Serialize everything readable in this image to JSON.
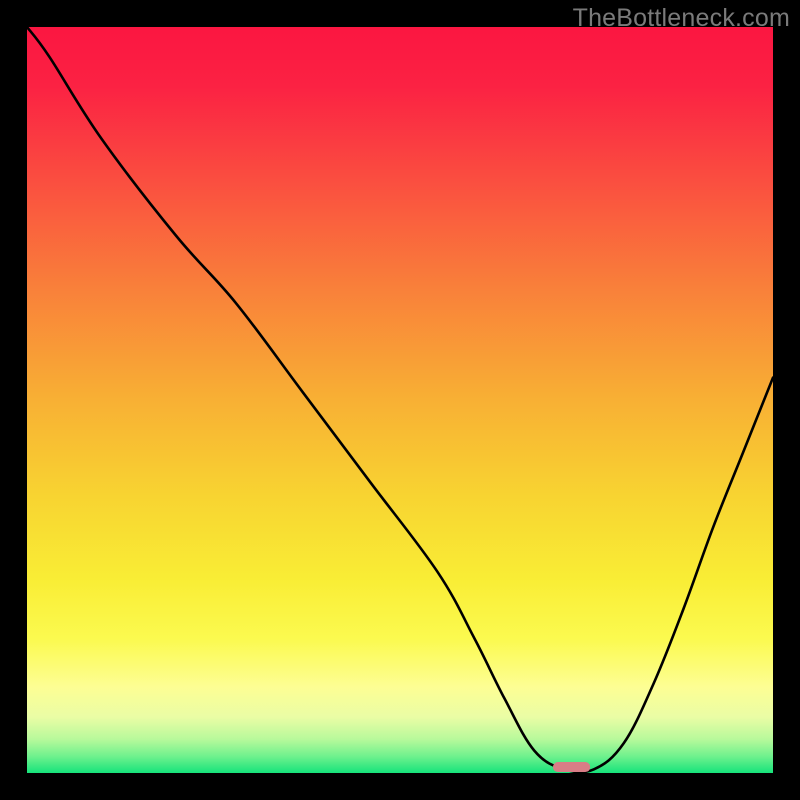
{
  "watermark": "TheBottleneck.com",
  "chart_data": {
    "type": "line",
    "title": "",
    "xlabel": "",
    "ylabel": "",
    "x_range": [
      0,
      100
    ],
    "y_range": [
      0,
      100
    ],
    "series": [
      {
        "name": "curve",
        "x": [
          0,
          3,
          10,
          20,
          28,
          37,
          46,
          55,
          60,
          64,
          68,
          72,
          76,
          80,
          84,
          88,
          92,
          96,
          100
        ],
        "y": [
          100,
          96,
          85,
          72,
          63,
          51,
          39,
          27,
          18,
          10,
          3,
          0.5,
          0.5,
          4,
          12,
          22,
          33,
          43,
          53
        ]
      }
    ],
    "marker": {
      "x": 73,
      "y": 0.8,
      "width": 5,
      "color": "#d87d86"
    },
    "background_gradient": {
      "stops": [
        {
          "offset": 0.0,
          "color": "#fb1641"
        },
        {
          "offset": 0.08,
          "color": "#fb2243"
        },
        {
          "offset": 0.2,
          "color": "#fa4c40"
        },
        {
          "offset": 0.35,
          "color": "#f9803a"
        },
        {
          "offset": 0.5,
          "color": "#f8b034"
        },
        {
          "offset": 0.63,
          "color": "#f8d431"
        },
        {
          "offset": 0.74,
          "color": "#f9ed35"
        },
        {
          "offset": 0.82,
          "color": "#fbfa4f"
        },
        {
          "offset": 0.885,
          "color": "#fdfe94"
        },
        {
          "offset": 0.925,
          "color": "#eafda5"
        },
        {
          "offset": 0.955,
          "color": "#b7f99b"
        },
        {
          "offset": 0.978,
          "color": "#6ef18d"
        },
        {
          "offset": 1.0,
          "color": "#16e37b"
        }
      ]
    }
  }
}
